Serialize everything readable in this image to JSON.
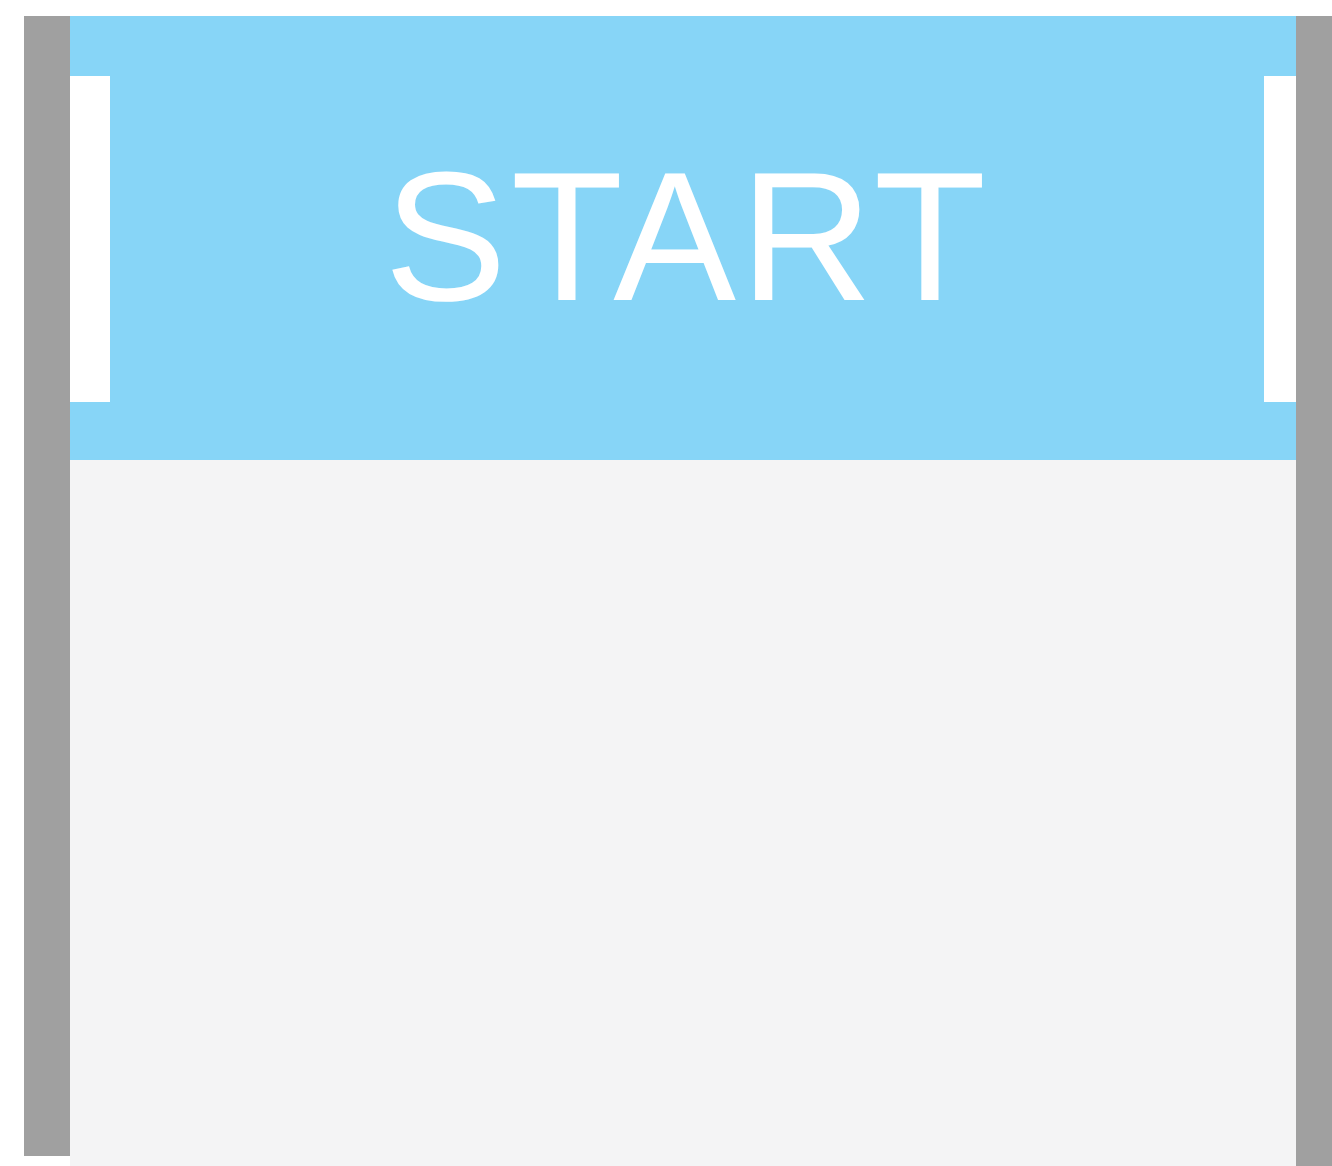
{
  "header": {
    "title": "START"
  }
}
